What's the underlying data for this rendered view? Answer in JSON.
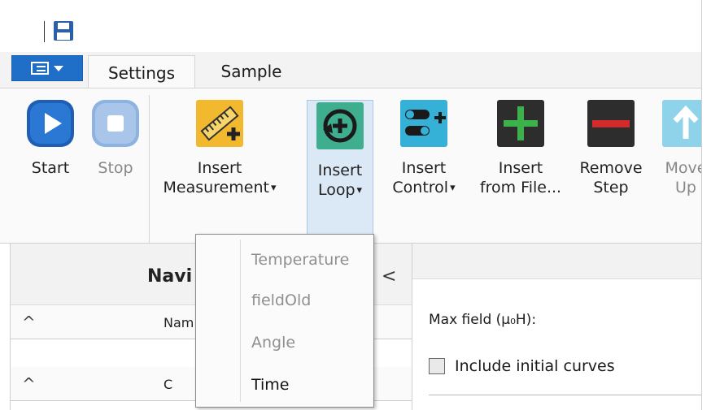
{
  "tabs": [
    {
      "label": "Settings"
    },
    {
      "label": "Sample"
    }
  ],
  "ribbon": {
    "start": "Start",
    "stop": "Stop",
    "insert_measurement": [
      "Insert",
      "Measurement"
    ],
    "insert_loop": [
      "Insert",
      "Loop"
    ],
    "insert_control": [
      "Insert",
      "Control"
    ],
    "insert_from_file": [
      "Insert",
      "from File..."
    ],
    "remove_step": [
      "Remove",
      "Step"
    ],
    "move_up": [
      "Move",
      "Up"
    ]
  },
  "navigator": {
    "title": "Navi",
    "collapse": "<",
    "row1": "Nam",
    "row2": "C"
  },
  "dropdown": {
    "items": [
      "Temperature",
      "fieldOld",
      "Angle",
      "Time"
    ]
  },
  "settings": {
    "max_field_label": "Max field (μ₀H):",
    "include_initial_curves": "Include initial curves"
  },
  "colors": {
    "accent": "#1f6ec8",
    "start_icon": "#1e5fb4",
    "stop_icon": "#7ea7d8",
    "measurement_icon": "#f2b82e",
    "loop_icon": "#3fae8f",
    "control_icon": "#35b0d6",
    "from_file_icon": "#1f8b4c",
    "remove_icon": "#d22b2b"
  }
}
